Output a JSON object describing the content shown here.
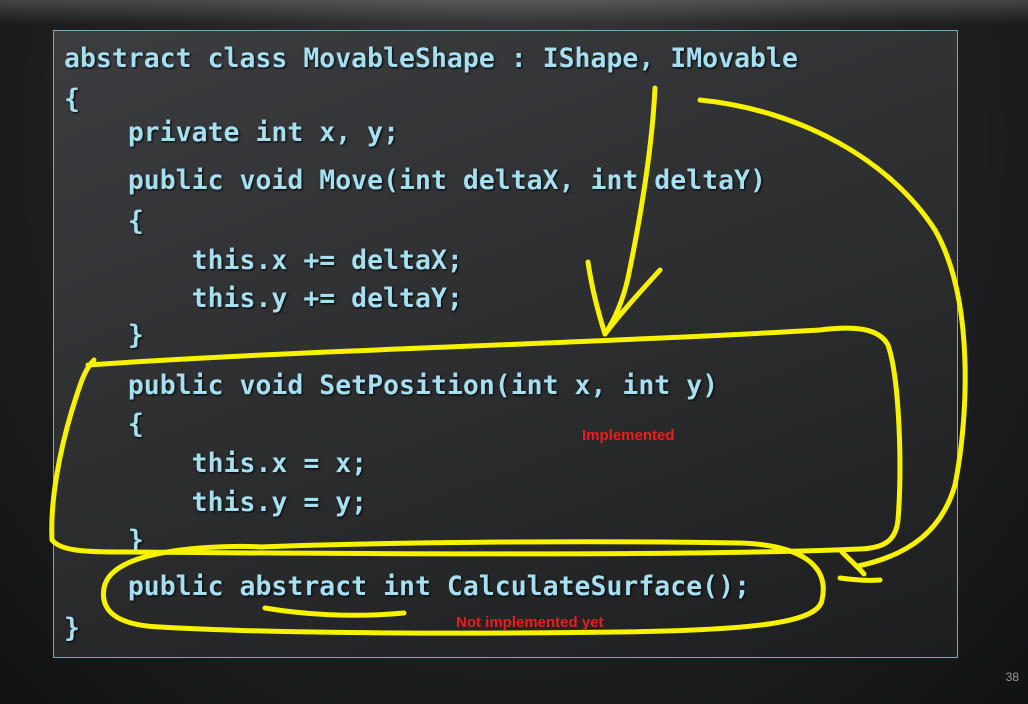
{
  "code_lines": [
    "abstract class MovableShape : IShape, IMovable",
    "{",
    "    private int x, y;",
    "    public void Move(int deltaX, int deltaY)",
    "    {",
    "        this.x += deltaX;",
    "        this.y += deltaY;",
    "    }",
    "    public void SetPosition(int x, int y)",
    "    {",
    "        this.x = x;",
    "        this.y = y;",
    "    }",
    "    public abstract int CalculateSurface();",
    "}"
  ],
  "annotations": {
    "implemented": "Implemented",
    "not_implemented": "Not implemented yet",
    "ink_color": "#f7f200",
    "note_color": "#ee1c1c"
  },
  "slide_number": "38",
  "colors": {
    "code_text": "#a5dff0",
    "box_border": "#7fa8b5"
  }
}
